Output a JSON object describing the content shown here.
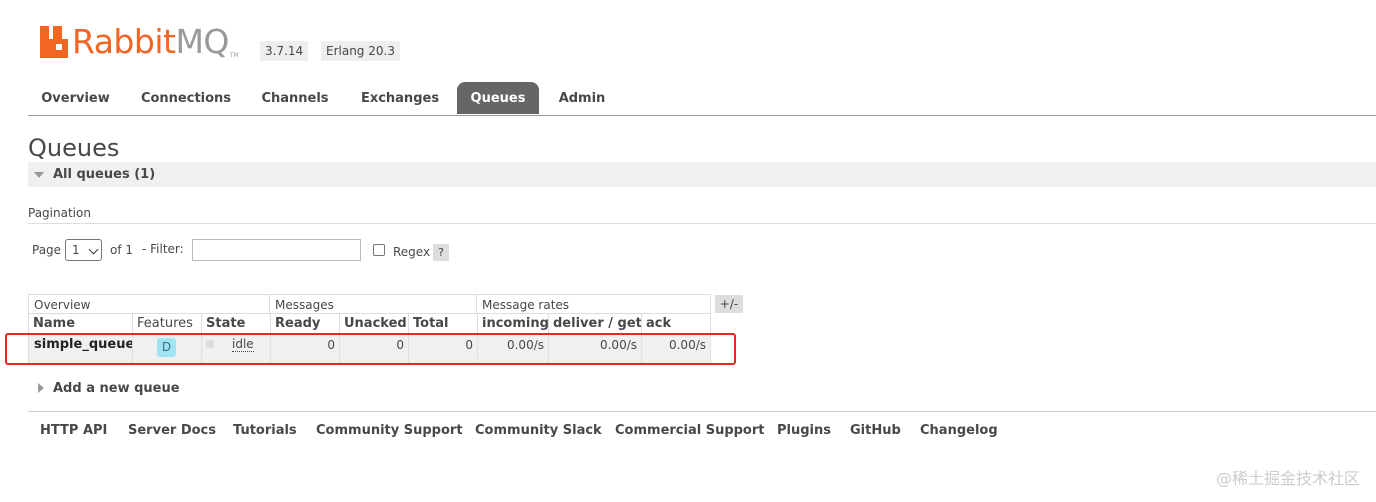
{
  "brand": {
    "rabbit": "Rabbit",
    "mq": "MQ",
    "tm": "TM"
  },
  "versions": {
    "rabbitmq": "3.7.14",
    "erlang": "Erlang 20.3"
  },
  "nav": {
    "tabs": [
      {
        "label": "Overview"
      },
      {
        "label": "Connections"
      },
      {
        "label": "Channels"
      },
      {
        "label": "Exchanges"
      },
      {
        "label": "Queues",
        "active": true
      },
      {
        "label": "Admin"
      }
    ]
  },
  "page": {
    "title": "Queues",
    "section": "All queues (1)"
  },
  "pagination": {
    "heading": "Pagination",
    "page_label": "Page",
    "page_value": "1",
    "of_label": "of 1",
    "filter_label": "- Filter:",
    "filter_value": "",
    "regex_label": "Regex",
    "help": "?"
  },
  "table": {
    "groups": {
      "overview": "Overview",
      "messages": "Messages",
      "rates": "Message rates"
    },
    "columns_toggle": "+/-",
    "headers": {
      "name": "Name",
      "features": "Features",
      "state": "State",
      "ready": "Ready",
      "unacked": "Unacked",
      "total": "Total",
      "incoming": "incoming",
      "deliver_get": "deliver / get",
      "ack": "ack"
    },
    "rows": [
      {
        "name": "simple_queue",
        "feature": "D",
        "state": "idle",
        "ready": "0",
        "unacked": "0",
        "total": "0",
        "incoming": "0.00/s",
        "deliver_get": "0.00/s",
        "ack": "0.00/s"
      }
    ]
  },
  "add_queue": "Add a new queue",
  "footer": {
    "links": [
      "HTTP API",
      "Server Docs",
      "Tutorials",
      "Community Support",
      "Community Slack",
      "Commercial Support",
      "Plugins",
      "GitHub",
      "Changelog"
    ]
  },
  "watermark": "@稀土掘金技术社区",
  "colors": {
    "brand_orange": "#f26522",
    "active_tab": "#666666",
    "highlight_box": "#e02b20",
    "feature_badge": "#a0e4f2"
  }
}
